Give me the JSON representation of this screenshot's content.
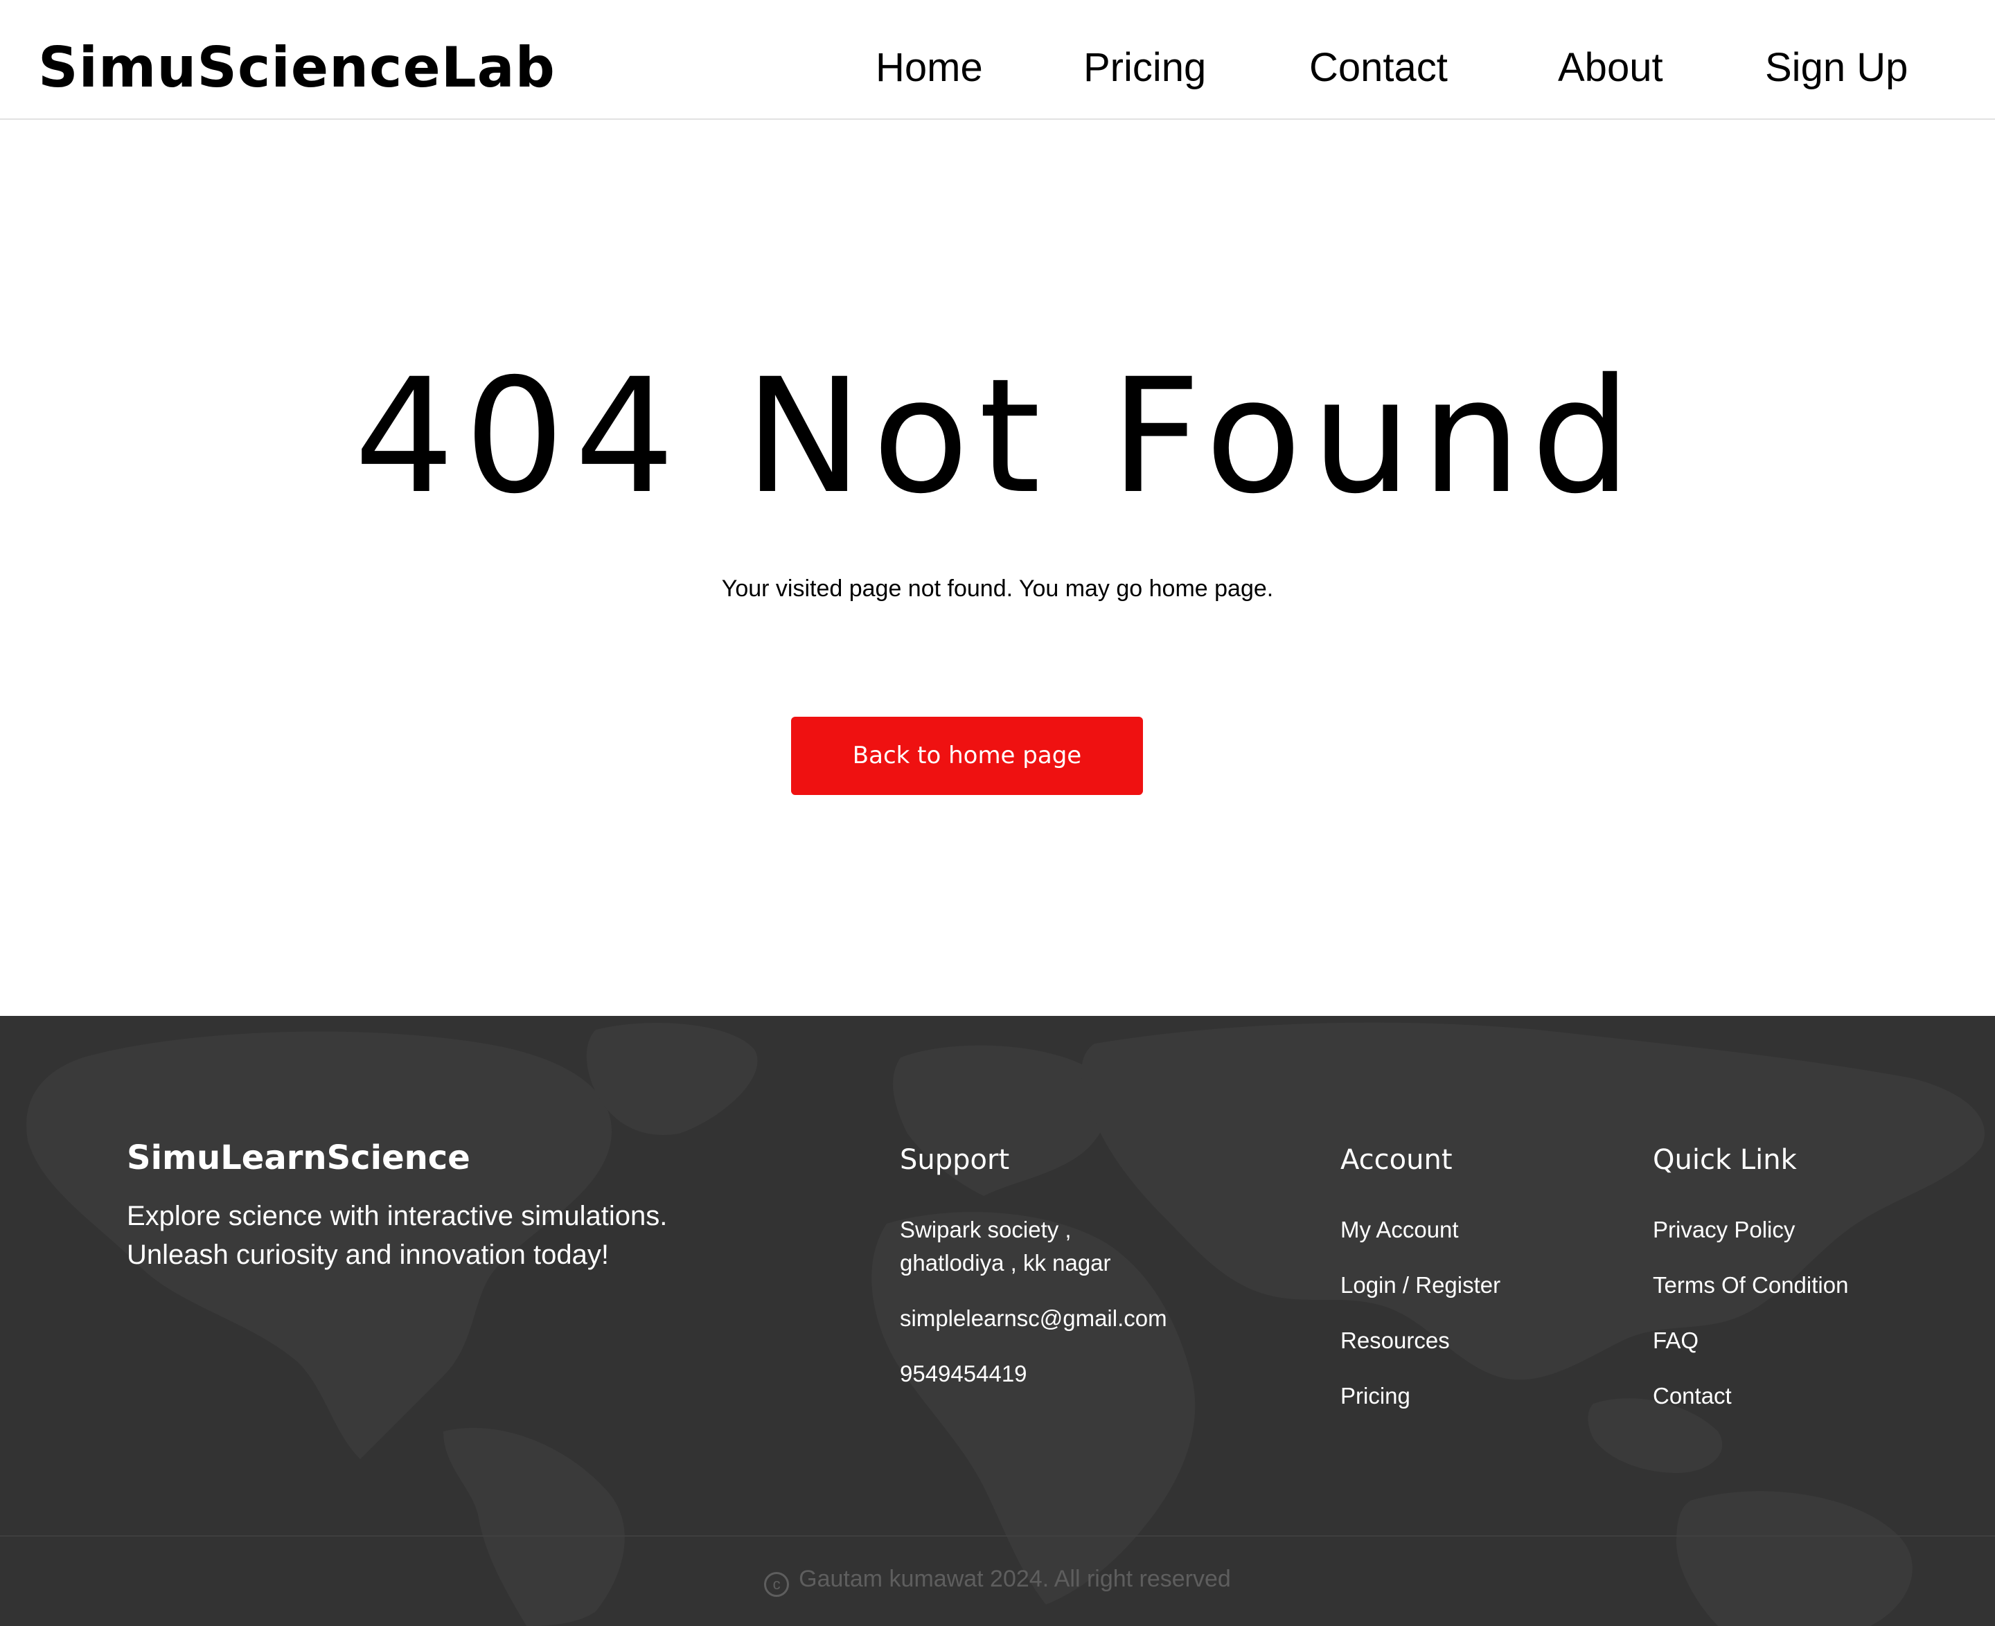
{
  "header": {
    "logo": "SimuScienceLab",
    "nav": [
      "Home",
      "Pricing",
      "Contact",
      "About",
      "Sign Up"
    ]
  },
  "main": {
    "title": "404 Not Found",
    "subtitle": "Your visited page not found. You may go home page.",
    "button_label": "Back to home page"
  },
  "footer": {
    "brand": "SimuLearnScience",
    "tagline": [
      "Explore science with interactive simulations.",
      "Unleash curiosity and innovation today!"
    ],
    "support": {
      "heading": "Support",
      "address": [
        "Swipark society ,",
        "ghatlodiya , kk nagar"
      ],
      "email": "simplelearnsc@gmail.com",
      "phone": "9549454419"
    },
    "account": {
      "heading": "Account",
      "items": [
        "My Account",
        "Login / Register",
        "Resources",
        "Pricing"
      ]
    },
    "quick_link": {
      "heading": "Quick Link",
      "items": [
        "Privacy Policy",
        "Terms Of Condition",
        "FAQ",
        "Contact"
      ]
    },
    "copyright_symbol": "c",
    "copyright": "Gautam kumawat 2024. All right reserved"
  },
  "colors": {
    "accent_red": "#ef1111",
    "footer_bg": "#333333",
    "map_shade": "#3a3a3a",
    "copyright_text": "#5e5e5e"
  },
  "icons": [
    "copyright-icon",
    "world-map-background"
  ]
}
